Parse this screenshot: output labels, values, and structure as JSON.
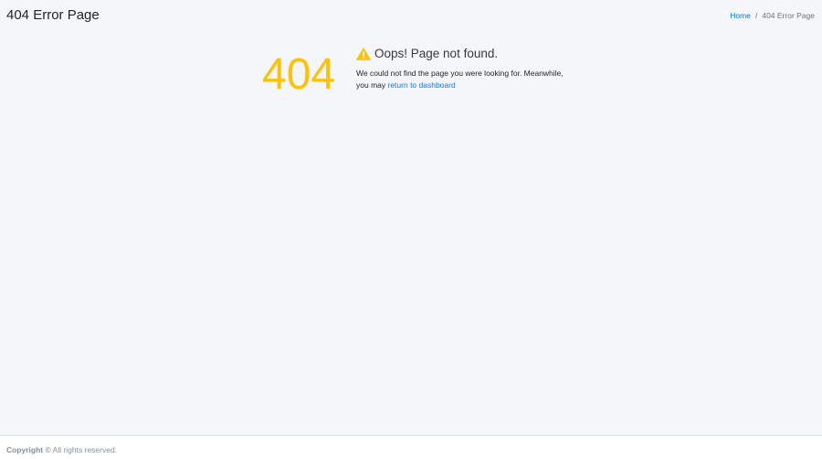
{
  "header": {
    "title": "404 Error Page"
  },
  "breadcrumb": {
    "home_label": "Home",
    "separator": "/",
    "current_label": "404 Error Page"
  },
  "error": {
    "code": "404",
    "title": "Oops! Page not found.",
    "icon": "warning-triangle-icon",
    "message_prefix": "We could not find the page you were looking for. Meanwhile, you may",
    "link_label": "return to dashboard"
  },
  "footer": {
    "copyright_label": "Copyright ©",
    "rights_text": " All rights reserved."
  },
  "colors": {
    "accent": "#ffc107",
    "link": "#007bff",
    "background": "#f4f6f9"
  }
}
